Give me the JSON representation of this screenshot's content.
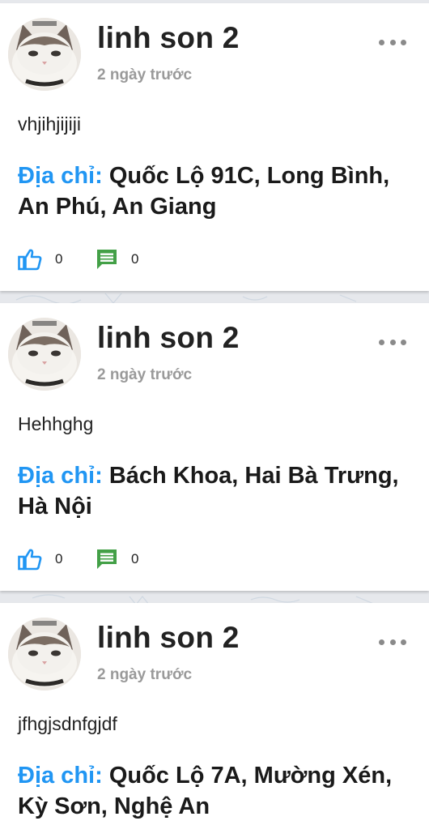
{
  "colors": {
    "accent": "#2196f3",
    "comment_icon": "#43a047",
    "muted": "#9a9a9a",
    "text": "#222222"
  },
  "address_label": "Địa chỉ:",
  "posts": [
    {
      "username": "linh son 2",
      "time": "2 ngày trước",
      "content": "vhjihjijiji",
      "address": "Quốc Lộ 91C, Long Bình, An Phú, An Giang",
      "likes": "0",
      "comments": "0"
    },
    {
      "username": "linh son 2",
      "time": "2 ngày trước",
      "content": "Hehhghg",
      "address": "Bách Khoa, Hai Bà Trưng, Hà Nội",
      "likes": "0",
      "comments": "0"
    },
    {
      "username": "linh son 2",
      "time": "2 ngày trước",
      "content": "jfhgjsdnfgjdf",
      "address": "Quốc Lộ 7A, Mường Xén, Kỳ Sơn, Nghệ An",
      "likes": "",
      "comments": ""
    }
  ]
}
